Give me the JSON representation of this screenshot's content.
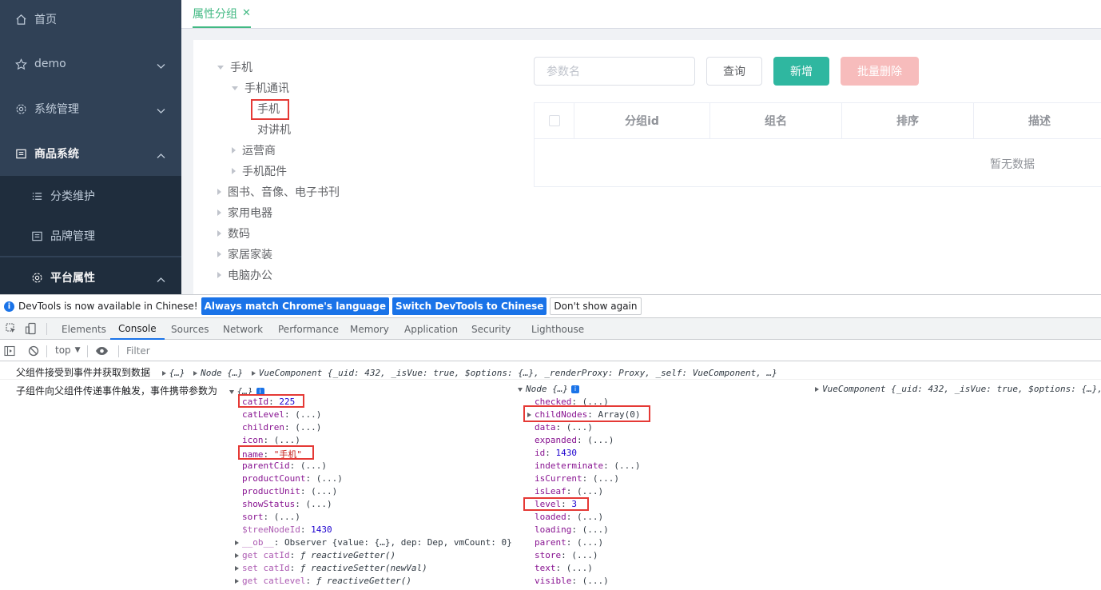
{
  "sidebar": {
    "items": [
      {
        "label": "首页",
        "icon": "home-icon"
      },
      {
        "label": "demo",
        "icon": "star-icon"
      },
      {
        "label": "系统管理",
        "icon": "gear-icon"
      },
      {
        "label": "商品系统",
        "icon": "book-icon"
      },
      {
        "label": "分类维护",
        "icon": "list-icon"
      },
      {
        "label": "品牌管理",
        "icon": "table-icon"
      },
      {
        "label": "平台属性",
        "icon": "gear-icon"
      }
    ]
  },
  "tabs": [
    {
      "label": "属性分组",
      "close": "✕"
    }
  ],
  "tree": [
    {
      "label": "手机"
    },
    {
      "label": "手机通讯"
    },
    {
      "label": "手机"
    },
    {
      "label": "对讲机"
    },
    {
      "label": "运营商"
    },
    {
      "label": "手机配件"
    },
    {
      "label": "图书、音像、电子书刊"
    },
    {
      "label": "家用电器"
    },
    {
      "label": "数码"
    },
    {
      "label": "家居家装"
    },
    {
      "label": "电脑办公"
    }
  ],
  "search": {
    "placeholder": "参数名"
  },
  "buttons": {
    "query": "查询",
    "add": "新增",
    "batch_delete": "批量删除"
  },
  "table": {
    "columns": [
      "分组id",
      "组名",
      "排序",
      "描述"
    ],
    "empty_text": "暂无数据"
  },
  "devtools_banner": {
    "text": "DevTools is now available in Chinese!",
    "btn_match": "Always match Chrome's language",
    "btn_switch": "Switch DevTools to Chinese",
    "btn_dismiss": "Don't show again"
  },
  "devtools_tabs": [
    "Elements",
    "Console",
    "Sources",
    "Network",
    "Performance",
    "Memory",
    "Application",
    "Security",
    "Lighthouse"
  ],
  "console_toolbar": {
    "context": "top",
    "filter_placeholder": "Filter"
  },
  "console": {
    "line1_msg": "父组件接受到事件并获取到数据",
    "line1_obj": "{…}",
    "line1_node": "Node {…}",
    "line1_vue": "VueComponent {_uid: 432, _isVue: true, $options: {…}, _renderProxy: Proxy, _self: VueComponent, …}",
    "line2_msg": "子组件向父组件传递事件触发，事件携带参数为",
    "line2_obj": "{…}",
    "line2_node": "Node {…}",
    "line2_vue": "VueComponent {_uid: 432, _isVue: true, $options: {…},",
    "obj_props": [
      {
        "k": "catId",
        "v": "225"
      },
      {
        "k": "catLevel",
        "v": "(...)"
      },
      {
        "k": "children",
        "v": "(...)"
      },
      {
        "k": "icon",
        "v": "(...)"
      },
      {
        "k": "name",
        "v": "\"手机\""
      },
      {
        "k": "parentCid",
        "v": "(...)"
      },
      {
        "k": "productCount",
        "v": "(...)"
      },
      {
        "k": "productUnit",
        "v": "(...)"
      },
      {
        "k": "showStatus",
        "v": "(...)"
      },
      {
        "k": "sort",
        "v": "(...)"
      },
      {
        "k": "$treeNodeId",
        "v": "1430"
      },
      {
        "k": "__ob__",
        "v": "Observer {value: {…}, dep: Dep, vmCount: 0}"
      },
      {
        "k": "get catId",
        "v": "ƒ reactiveGetter()"
      },
      {
        "k": "set catId",
        "v": "ƒ reactiveSetter(newVal)"
      },
      {
        "k": "get catLevel",
        "v": "ƒ reactiveGetter()"
      }
    ],
    "node_props": [
      {
        "k": "checked",
        "v": "(...)"
      },
      {
        "k": "childNodes",
        "v": "Array(0)"
      },
      {
        "k": "data",
        "v": "(...)"
      },
      {
        "k": "expanded",
        "v": "(...)"
      },
      {
        "k": "id",
        "v": "1430"
      },
      {
        "k": "indeterminate",
        "v": "(...)"
      },
      {
        "k": "isCurrent",
        "v": "(...)"
      },
      {
        "k": "isLeaf",
        "v": "(...)"
      },
      {
        "k": "level",
        "v": "3"
      },
      {
        "k": "loaded",
        "v": "(...)"
      },
      {
        "k": "loading",
        "v": "(...)"
      },
      {
        "k": "parent",
        "v": "(...)"
      },
      {
        "k": "store",
        "v": "(...)"
      },
      {
        "k": "text",
        "v": "(...)"
      },
      {
        "k": "visible",
        "v": "(...)"
      }
    ]
  },
  "colors": {
    "sidebar_bg": "#304156",
    "accent": "#42b983",
    "highlight": "#e53935",
    "devtools_blue": "#1a73e8"
  }
}
